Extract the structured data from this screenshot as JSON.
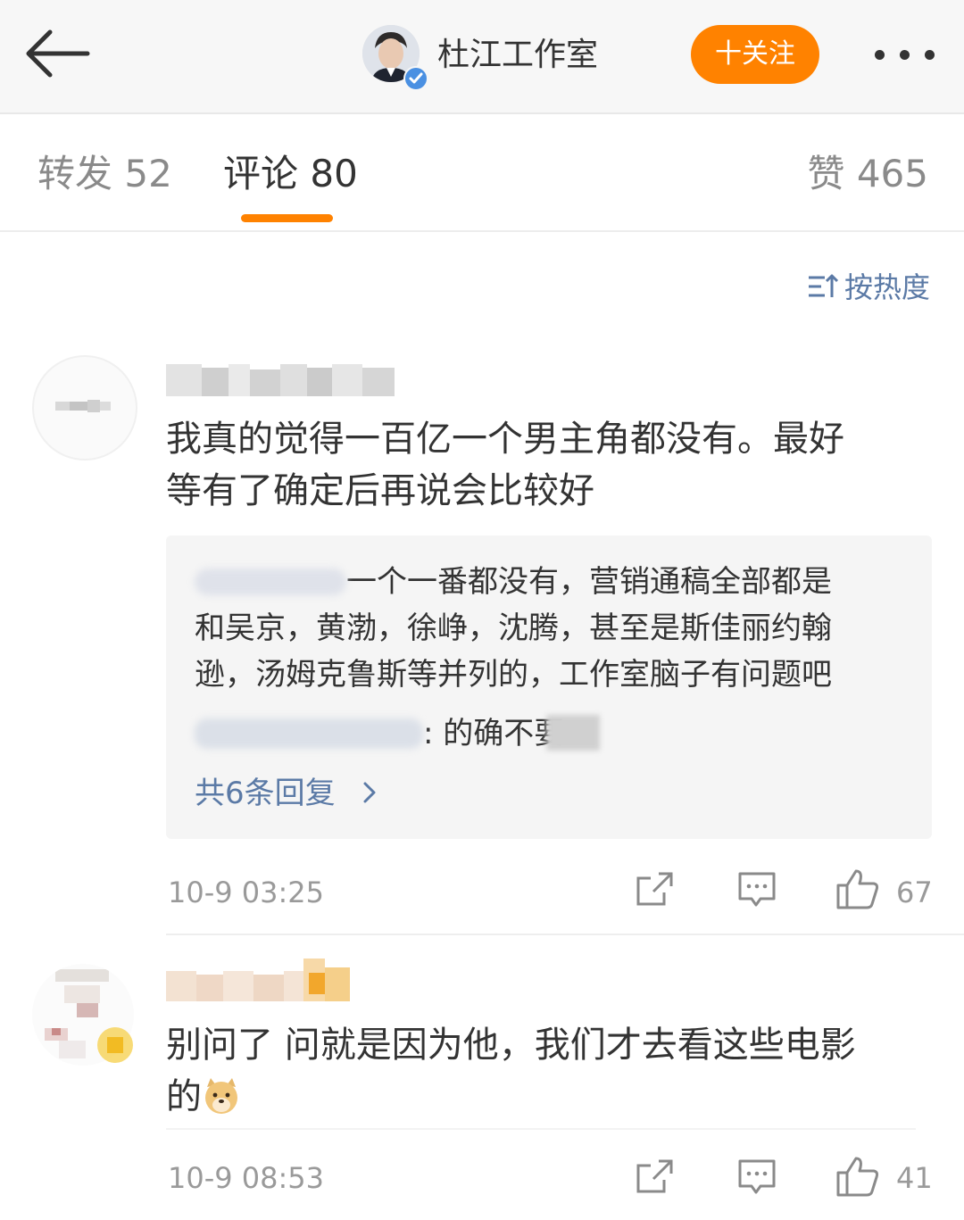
{
  "topbar": {
    "account_name": "杜江工作室",
    "follow_label": "十关注"
  },
  "tabs": {
    "repost": "转发 52",
    "comment": "评论 80",
    "like": "赞 465"
  },
  "sort_label": "按热度",
  "comments": [
    {
      "text_line1": "我真的觉得一百亿一个男主角都没有。最好",
      "text_line2": "等有了确定后再说会比较好",
      "replies": [
        "一个一番都没有，营销通稿全部都是",
        "和吴京，黄渤，徐峥，沈腾，甚至是斯佳丽约翰",
        "逊，汤姆克鲁斯等并列的，工作室脑子有问题吧",
        ": 的确不要"
      ],
      "reply_count_label": "共6条回复",
      "time": "10-9 03:25",
      "likes": "67"
    },
    {
      "text_line1": "别问了 问就是因为他，我们才去看这些电影",
      "text_line2": "的",
      "time": "10-9 08:53",
      "likes": "41"
    }
  ],
  "colors": {
    "accent": "#ff8200",
    "link": "#5b7aa6",
    "meta": "#9a9a9a"
  }
}
